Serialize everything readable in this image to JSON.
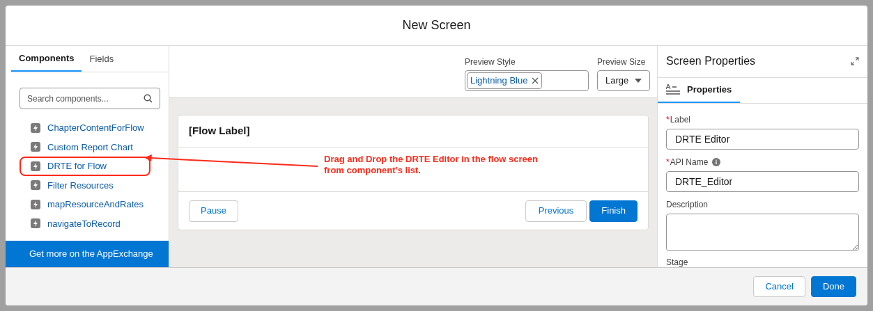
{
  "modal": {
    "title": "New Screen"
  },
  "left_tabs": [
    {
      "label": "Components",
      "selected": true
    },
    {
      "label": "Fields",
      "selected": false
    }
  ],
  "search": {
    "placeholder": "Search components..."
  },
  "components": [
    {
      "label": "ChapterContentForFlow",
      "highlighted": false
    },
    {
      "label": "Custom Report Chart",
      "highlighted": false
    },
    {
      "label": "DRTE for Flow",
      "highlighted": true
    },
    {
      "label": "Filter Resources",
      "highlighted": false
    },
    {
      "label": "mapResourceAndRates",
      "highlighted": false
    },
    {
      "label": "navigateToRecord",
      "highlighted": false
    }
  ],
  "appexchange": "Get more on the AppExchange",
  "preview_style": {
    "label": "Preview Style",
    "pill": "Lightning Blue"
  },
  "preview_size": {
    "label": "Preview Size",
    "value": "Large"
  },
  "flow_card": {
    "title": "[Flow Label]",
    "buttons": [
      {
        "label": "Pause",
        "kind": "neutral"
      },
      {
        "label": "Previous",
        "kind": "neutral"
      },
      {
        "label": "Finish",
        "kind": "brand"
      }
    ]
  },
  "annotation": {
    "lines": [
      "Drag and Drop the DRTE Editor in the flow screen",
      "from component’s list."
    ]
  },
  "properties": {
    "title": "Screen Properties",
    "tab": {
      "label": "Properties",
      "selected": true
    },
    "fields": [
      {
        "label": "Label",
        "required_mark": "*",
        "info": false,
        "value": "DRTE Editor",
        "kind": "input"
      },
      {
        "label": "API Name",
        "required_mark": "*",
        "info": true,
        "value": "DRTE_Editor",
        "kind": "input"
      },
      {
        "label": "Description",
        "info": false,
        "kind": "textarea"
      }
    ],
    "cut_label": "Stage"
  },
  "footer": [
    {
      "label": "Cancel",
      "kind": "neutral"
    },
    {
      "label": "Done",
      "kind": "brand"
    }
  ]
}
